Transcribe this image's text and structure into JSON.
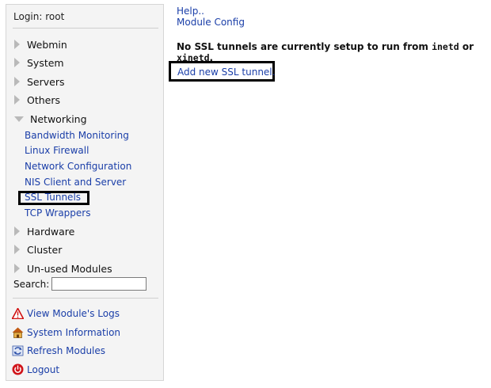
{
  "sidebar": {
    "login": "Login: root",
    "categories": [
      {
        "label": "Webmin"
      },
      {
        "label": "System"
      },
      {
        "label": "Servers"
      },
      {
        "label": "Others"
      },
      {
        "label": "Networking"
      },
      {
        "label": "Hardware"
      },
      {
        "label": "Cluster"
      },
      {
        "label": "Un-used Modules"
      }
    ],
    "networking_modules": [
      {
        "label": "Bandwidth Monitoring"
      },
      {
        "label": "Linux Firewall"
      },
      {
        "label": "Network Configuration"
      },
      {
        "label": "NIS Client and Server"
      },
      {
        "label": "SSL Tunnels",
        "selected": true
      },
      {
        "label": "TCP Wrappers"
      }
    ],
    "search_label": "Search:",
    "search_value": "",
    "actions": [
      {
        "label": "View Module's Logs",
        "icon": "warning-icon"
      },
      {
        "label": "System Information",
        "icon": "home-icon"
      },
      {
        "label": "Refresh Modules",
        "icon": "refresh-icon"
      },
      {
        "label": "Logout",
        "icon": "power-icon"
      }
    ]
  },
  "main": {
    "help_link": "Help..",
    "config_link": "Module Config",
    "message_prefix": "No SSL tunnels are currently setup to run from ",
    "message_code1": "inetd",
    "message_mid": " or ",
    "message_code2": "xinetd",
    "message_suffix": ".",
    "add_link": "Add new SSL tunnel."
  },
  "colors": {
    "link": "#1a3ea8",
    "sidebar_bg": "#f4f4f4",
    "highlight_border": "#000000"
  }
}
